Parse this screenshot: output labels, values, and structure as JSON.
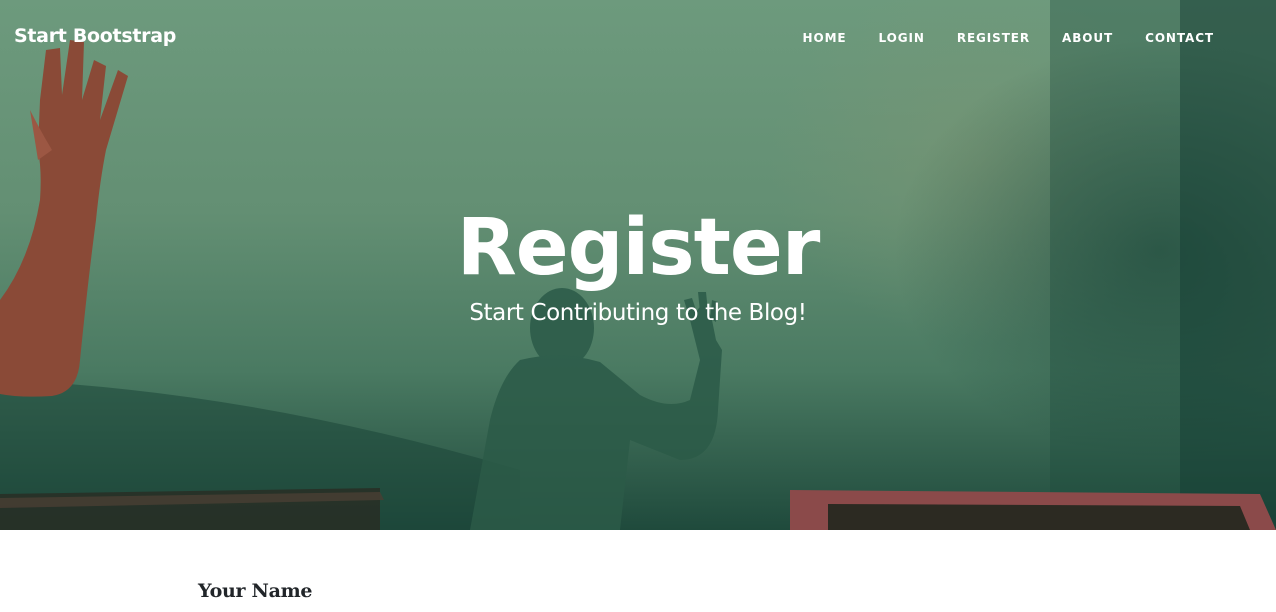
{
  "navbar": {
    "brand": "Start Bootstrap",
    "links": [
      {
        "label": "HOME"
      },
      {
        "label": "LOGIN"
      },
      {
        "label": "REGISTER"
      },
      {
        "label": "ABOUT"
      },
      {
        "label": "CONTACT"
      }
    ]
  },
  "header": {
    "title": "Register",
    "subtitle": "Start Contributing to the Blog!"
  },
  "form": {
    "name_label": "Your Name"
  },
  "colors": {
    "hero_green": "#6d9a7d",
    "text_white": "#ffffff",
    "label_dark": "#212529"
  }
}
